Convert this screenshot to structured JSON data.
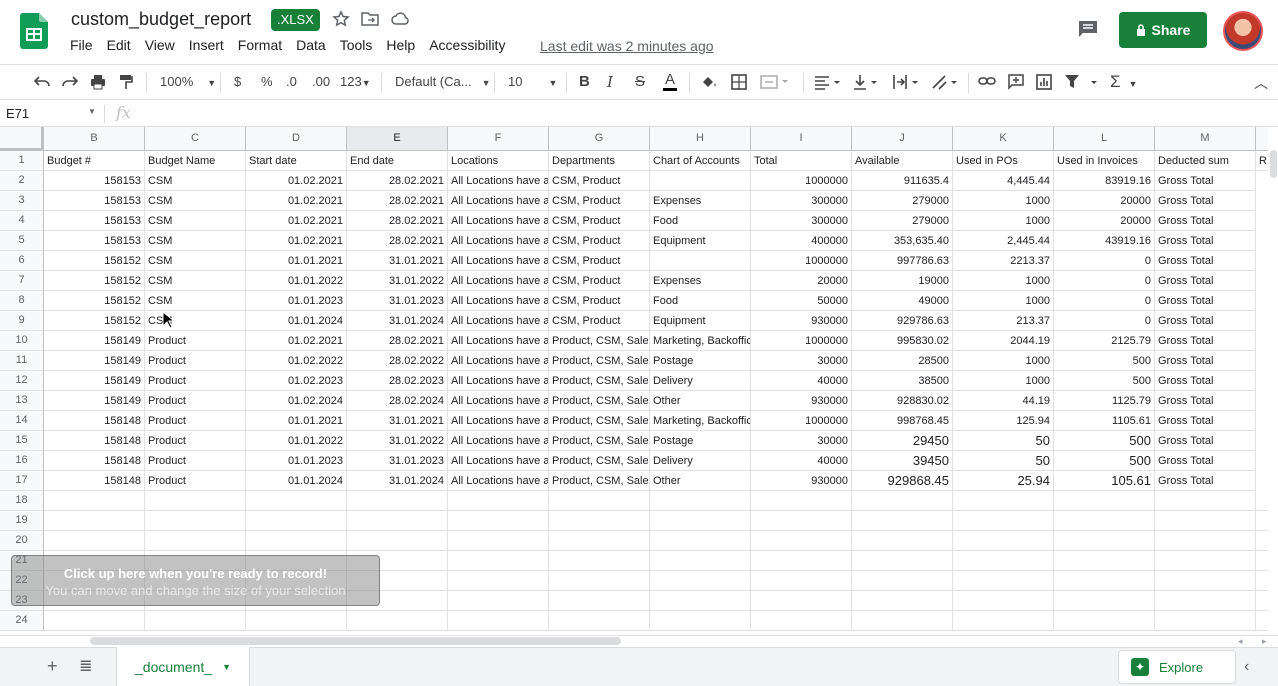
{
  "doc": {
    "title": "custom_budget_report",
    "badge": ".XLSX"
  },
  "menu": [
    "File",
    "Edit",
    "View",
    "Insert",
    "Format",
    "Data",
    "Tools",
    "Help",
    "Accessibility"
  ],
  "last_edit": "Last edit was 2 minutes ago",
  "share_label": "Share",
  "toolbar": {
    "zoom": "100%",
    "currency": "$",
    "percent": "%",
    "dec_dec": ".0",
    "dec_inc": ".00",
    "format_more": "123",
    "font": "Default (Ca...",
    "font_size": "10",
    "bold": "B",
    "italic": "I",
    "strike": "S",
    "text_color": "A"
  },
  "name_box": "E71",
  "fx": "fx",
  "columns": [
    "B",
    "C",
    "D",
    "E",
    "F",
    "G",
    "H",
    "I",
    "J",
    "K",
    "L",
    "M"
  ],
  "selected_column": "E",
  "row_numbers": [
    "1",
    "2",
    "3",
    "4",
    "5",
    "6",
    "7",
    "8",
    "9",
    "10",
    "11",
    "12",
    "13",
    "14",
    "15",
    "16",
    "17",
    "18",
    "19",
    "20",
    "21",
    "22",
    "23",
    "24"
  ],
  "header_row": [
    "Budget #",
    "Budget Name",
    "Start date",
    "End date",
    "Locations",
    "Departments",
    "Chart of Accounts",
    "Total",
    "Available",
    "Used in POs",
    "Used in Invoices",
    "Deducted sum",
    "R"
  ],
  "rows": [
    [
      "158153",
      "CSM",
      "01.02.2021",
      "28.02.2021",
      "All Locations have ac",
      "CSM, Product",
      "",
      "1000000",
      "911635.4",
      "4,445.44",
      "83919.16",
      "Gross Total"
    ],
    [
      "158153",
      "CSM",
      "01.02.2021",
      "28.02.2021",
      "All Locations have ac",
      "CSM, Product",
      "Expenses",
      "300000",
      "279000",
      "1000",
      "20000",
      "Gross Total"
    ],
    [
      "158153",
      "CSM",
      "01.02.2021",
      "28.02.2021",
      "All Locations have ac",
      "CSM, Product",
      "Food",
      "300000",
      "279000",
      "1000",
      "20000",
      "Gross Total"
    ],
    [
      "158153",
      "CSM",
      "01.02.2021",
      "28.02.2021",
      "All Locations have ac",
      "CSM, Product",
      "Equipment",
      "400000",
      "353,635.40",
      "2,445.44",
      "43919.16",
      "Gross Total"
    ],
    [
      "158152",
      "CSM",
      "01.01.2021",
      "31.01.2021",
      "All Locations have ac",
      "CSM, Product",
      "",
      "1000000",
      "997786.63",
      "2213.37",
      "0",
      "Gross Total"
    ],
    [
      "158152",
      "CSM",
      "01.01.2022",
      "31.01.2022",
      "All Locations have ac",
      "CSM, Product",
      "Expenses",
      "20000",
      "19000",
      "1000",
      "0",
      "Gross Total"
    ],
    [
      "158152",
      "CSM",
      "01.01.2023",
      "31.01.2023",
      "All Locations have ac",
      "CSM, Product",
      "Food",
      "50000",
      "49000",
      "1000",
      "0",
      "Gross Total"
    ],
    [
      "158152",
      "CSM",
      "01.01.2024",
      "31.01.2024",
      "All Locations have ac",
      "CSM, Product",
      "Equipment",
      "930000",
      "929786.63",
      "213.37",
      "0",
      "Gross Total"
    ],
    [
      "158149",
      "Product",
      "01.02.2021",
      "28.02.2021",
      "All Locations have ac",
      "Product, CSM, Sales",
      "Marketing, Backoffic",
      "1000000",
      "995830.02",
      "2044.19",
      "2125.79",
      "Gross Total"
    ],
    [
      "158149",
      "Product",
      "01.02.2022",
      "28.02.2022",
      "All Locations have ac",
      "Product, CSM, Sales",
      "Postage",
      "30000",
      "28500",
      "1000",
      "500",
      "Gross Total"
    ],
    [
      "158149",
      "Product",
      "01.02.2023",
      "28.02.2023",
      "All Locations have ac",
      "Product, CSM, Sales",
      "Delivery",
      "40000",
      "38500",
      "1000",
      "500",
      "Gross Total"
    ],
    [
      "158149",
      "Product",
      "01.02.2024",
      "28.02.2024",
      "All Locations have ac",
      "Product, CSM, Sales",
      "Other",
      "930000",
      "928830.02",
      "44.19",
      "1125.79",
      "Gross Total"
    ],
    [
      "158148",
      "Product",
      "01.01.2021",
      "31.01.2021",
      "All Locations have ac",
      "Product, CSM, Sales",
      "Marketing, Backoffic",
      "1000000",
      "998768.45",
      "125.94",
      "1105.61",
      "Gross Total"
    ],
    [
      "158148",
      "Product",
      "01.01.2022",
      "31.01.2022",
      "All Locations have ac",
      "Product, CSM, Sales",
      "Postage",
      "30000",
      "29450",
      "50",
      "500",
      "Gross Total"
    ],
    [
      "158148",
      "Product",
      "01.01.2023",
      "31.01.2023",
      "All Locations have ac",
      "Product, CSM, Sales",
      "Delivery",
      "40000",
      "39450",
      "50",
      "500",
      "Gross Total"
    ],
    [
      "158148",
      "Product",
      "01.01.2024",
      "31.01.2024",
      "All Locations have ac",
      "Product, CSM, Sales",
      "Other",
      "930000",
      "929868.45",
      "25.94",
      "105.61",
      "Gross Total"
    ]
  ],
  "sheet_tab": "_document_",
  "explore_label": "Explore",
  "overlay": {
    "line1": "Click up here when you're ready to record!",
    "line2": "You can move and change the size of your selection"
  },
  "colors": {
    "accent": "#188038",
    "gridline": "#e2e2e2",
    "header_bg": "#f8f9fa"
  }
}
